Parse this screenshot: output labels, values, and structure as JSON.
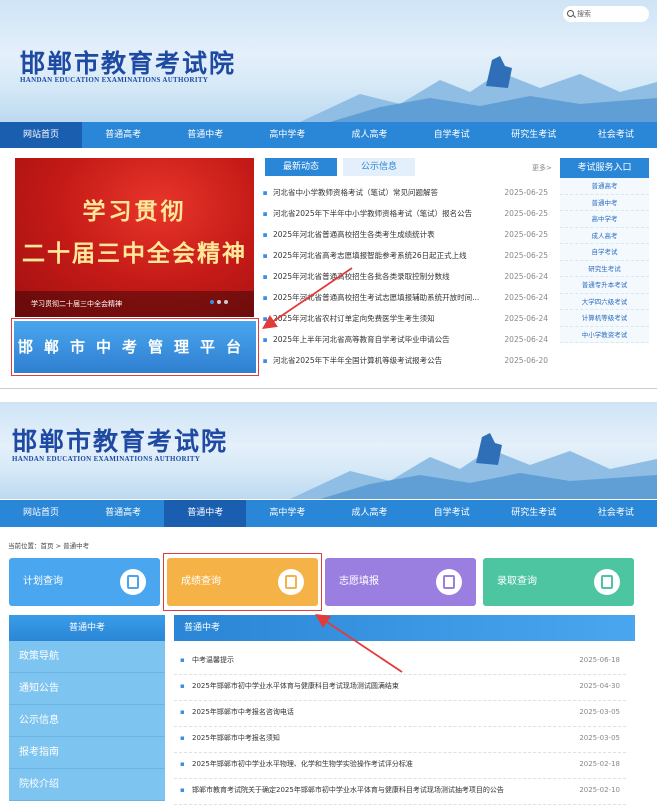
{
  "top": {
    "site_title": "邯郸市教育考试院",
    "site_subtitle": "HANDAN EDUCATION EXAMINATIONS AUTHORITY",
    "search_placeholder": "搜索",
    "nav": [
      "网站首页",
      "普通高考",
      "普通中考",
      "高中学考",
      "成人高考",
      "自学考试",
      "研究生考试",
      "社会考试"
    ],
    "promo": {
      "line1": "学习贯彻",
      "line2": "二十届三中全会精神",
      "caption": "学习贯彻二十届三中全会精神"
    },
    "zhongkao_button": "邯郸市中考管理平台",
    "news_tabs": [
      "最新动态",
      "公示信息"
    ],
    "more": "更多>",
    "news": [
      {
        "title": "河北省中小学教师资格考试（笔试）常见问题解答",
        "date": "2025-06-25"
      },
      {
        "title": "河北省2025年下半年中小学教师资格考试（笔试）报名公告",
        "date": "2025-06-25"
      },
      {
        "title": "2025年河北省普通高校招生各类考生成绩统计表",
        "date": "2025-06-25"
      },
      {
        "title": "2025年河北省高考志愿填报智能参考系统26日起正式上线",
        "date": "2025-06-25"
      },
      {
        "title": "2025年河北省普通高校招生各批各类录取控制分数线",
        "date": "2025-06-24"
      },
      {
        "title": "2025年河北省普通高校招生考试志愿填报辅助系统开放时间...",
        "date": "2025-06-24"
      },
      {
        "title": "2025年河北省农村订单定向免费医学生考生须知",
        "date": "2025-06-24"
      },
      {
        "title": "2025年上半年河北省高等教育自学考试毕业申请公告",
        "date": "2025-06-24"
      },
      {
        "title": "河北省2025年下半年全国计算机等级考试报考公告",
        "date": "2025-06-20"
      }
    ],
    "services_title": "考试服务入口",
    "services": [
      "普通高考",
      "普通中考",
      "高中学考",
      "成人高考",
      "自学考试",
      "研究生考试",
      "普通专升本考试",
      "大学四六级考试",
      "计算机等级考试",
      "中小学教资考试"
    ]
  },
  "bottom": {
    "site_title": "邯郸市教育考试院",
    "site_subtitle": "HANDAN EDUCATION EXAMINATIONS AUTHORITY",
    "nav": [
      "网站首页",
      "普通高考",
      "普通中考",
      "高中学考",
      "成人高考",
      "自学考试",
      "研究生考试",
      "社会考试"
    ],
    "breadcrumb": "当前位置：首页 > 普通中考",
    "cards": [
      {
        "label": "计划查询",
        "color": "#4aa6ee"
      },
      {
        "label": "成绩查询",
        "color": "#f5b347"
      },
      {
        "label": "志愿填报",
        "color": "#9b7fe0"
      },
      {
        "label": "录取查询",
        "color": "#4cc5a0"
      }
    ],
    "sidebar_title": "普通中考",
    "sidebar": [
      "政策导航",
      "通知公告",
      "公示信息",
      "报考指南",
      "院校介绍"
    ],
    "list_title": "普通中考",
    "list": [
      {
        "title": "中考温馨提示",
        "date": "2025-06-18"
      },
      {
        "title": "2025年邯郸市初中学业水平体育与健康科目考试现场测试圆满结束",
        "date": "2025-04-30"
      },
      {
        "title": "2025年邯郸市中考报名咨询电话",
        "date": "2025-03-05"
      },
      {
        "title": "2025年邯郸市中考报名须知",
        "date": "2025-03-05"
      },
      {
        "title": "2025年邯郸市初中学业水平物理、化学和生物学实验操作考试评分标准",
        "date": "2025-02-18"
      },
      {
        "title": "邯郸市教育考试院关于确定2025年邯郸市初中学业水平体育与健康科目考试现场测试抽考项目的公告",
        "date": "2025-02-10"
      }
    ]
  },
  "colors": {
    "nav": "#2a86d6",
    "nav_active": "#1a5eb0",
    "accent": "#e23b3b"
  }
}
